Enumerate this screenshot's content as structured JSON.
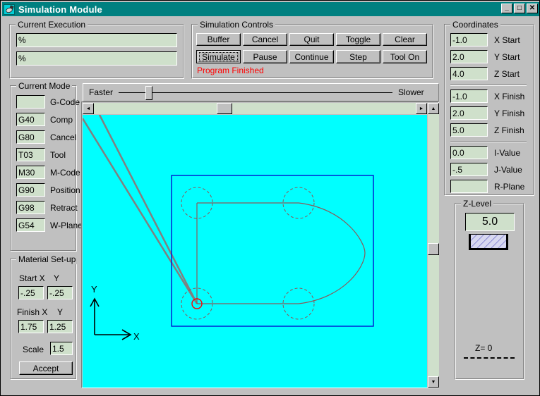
{
  "window": {
    "title": "Simulation Module",
    "icon": "simulation-app-icon",
    "buttons": {
      "minimize": "_",
      "maximize": "□",
      "close": "✕"
    }
  },
  "current_execution": {
    "legend": "Current Execution",
    "line1": "%",
    "line2": "%"
  },
  "simulation_controls": {
    "legend": "Simulation Controls",
    "row1": [
      "Buffer",
      "Cancel",
      "Quit",
      "Toggle",
      "Clear"
    ],
    "row2": [
      "Simulate",
      "Pause",
      "Continue",
      "Step",
      "Tool On"
    ],
    "default_button": "Simulate",
    "status": "Program Finished",
    "status_color": "#ff0000"
  },
  "coordinates": {
    "legend": "Coordinates",
    "rows": [
      {
        "value": "-1.0",
        "label": "X Start"
      },
      {
        "value": "2.0",
        "label": "Y Start"
      },
      {
        "value": "4.0",
        "label": "Z Start"
      },
      {
        "value": "-1.0",
        "label": "X Finish"
      },
      {
        "value": "2.0",
        "label": "Y Finish"
      },
      {
        "value": "5.0",
        "label": "Z Finish"
      },
      {
        "value": "0.0",
        "label": "I-Value"
      },
      {
        "value": "-.5",
        "label": "J-Value"
      },
      {
        "value": "",
        "label": "R-Plane"
      }
    ]
  },
  "current_mode": {
    "legend": "Current Mode",
    "rows": [
      {
        "value": "",
        "label": "G-Code"
      },
      {
        "value": "G40",
        "label": "Comp"
      },
      {
        "value": "G80",
        "label": "Cancel"
      },
      {
        "value": "T03",
        "label": "Tool"
      },
      {
        "value": "M30",
        "label": "M-Code"
      },
      {
        "value": "G90",
        "label": "Position"
      },
      {
        "value": "G98",
        "label": "Retract"
      },
      {
        "value": "G54",
        "label": "W-Plane"
      }
    ]
  },
  "material_setup": {
    "legend": "Material Set-up",
    "start_label_x": "Start X",
    "start_label_y": "Y",
    "start_x": "-.25",
    "start_y": "-.25",
    "finish_label_x": "Finish X",
    "finish_label_y": "Y",
    "finish_x": "1.75",
    "finish_y": "1.25",
    "scale_label": "Scale",
    "scale": "1.5",
    "accept_label": "Accept"
  },
  "speed_slider": {
    "faster_label": "Faster",
    "slower_label": "Slower",
    "position_percent": 17
  },
  "z_level": {
    "legend": "Z-Level",
    "value": "5.0",
    "zero_label": "Z= 0"
  },
  "canvas": {
    "background_color": "#00ffff",
    "stock_outline_color": "#0000cc",
    "toolpath_color": "#8a5a5a",
    "rapid_color": "#808080",
    "tool_marker_color": "#ff0000",
    "axis_label_x": "X",
    "axis_label_y": "Y"
  },
  "scrollbars": {
    "h_thumb_percent": 40,
    "v_thumb_percent": 52,
    "left_arrow": "◄",
    "right_arrow": "►",
    "up_arrow": "▲",
    "down_arrow": "▼"
  }
}
